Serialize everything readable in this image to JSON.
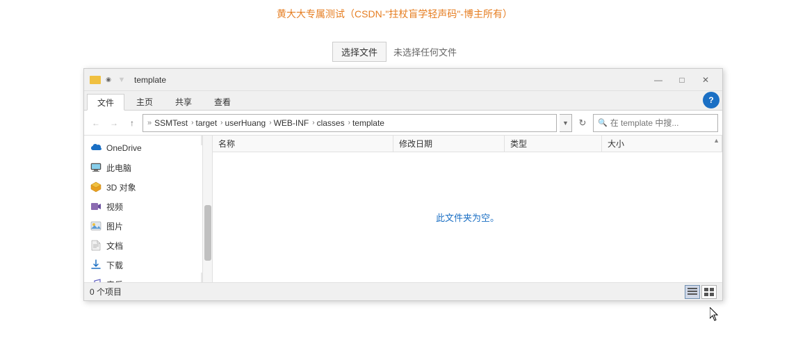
{
  "bg": {
    "title": "黄大大专属测试（CSDN-\"拄杖盲学轻声码\"-博主所有）",
    "choose_file_btn": "选择文件",
    "no_file_text": "未选择任何文件"
  },
  "explorer": {
    "title": "template",
    "title_bar": {
      "minimize": "—",
      "maximize": "□",
      "close": "✕"
    },
    "tabs": [
      {
        "label": "文件"
      },
      {
        "label": "主页"
      },
      {
        "label": "共享"
      },
      {
        "label": "查看"
      }
    ],
    "active_tab": 0,
    "breadcrumb": {
      "segments": [
        "SSMTest",
        "target",
        "userHuang",
        "WEB-INF",
        "classes",
        "template"
      ]
    },
    "search_placeholder": "在 template 中搜...",
    "sidebar": {
      "items": [
        {
          "label": "OneDrive",
          "icon": "cloud"
        },
        {
          "label": "此电脑",
          "icon": "computer"
        },
        {
          "label": "3D 对象",
          "icon": "3d"
        },
        {
          "label": "视频",
          "icon": "video"
        },
        {
          "label": "图片",
          "icon": "image"
        },
        {
          "label": "文档",
          "icon": "document"
        },
        {
          "label": "下载",
          "icon": "download"
        },
        {
          "label": "音乐",
          "icon": "music"
        }
      ]
    },
    "columns": {
      "name": "名称",
      "date": "修改日期",
      "type": "类型",
      "size": "大小"
    },
    "empty_message": "此文件夹为空。",
    "status": {
      "item_count": "0 个项目"
    },
    "view_modes": [
      "detail",
      "preview"
    ]
  }
}
